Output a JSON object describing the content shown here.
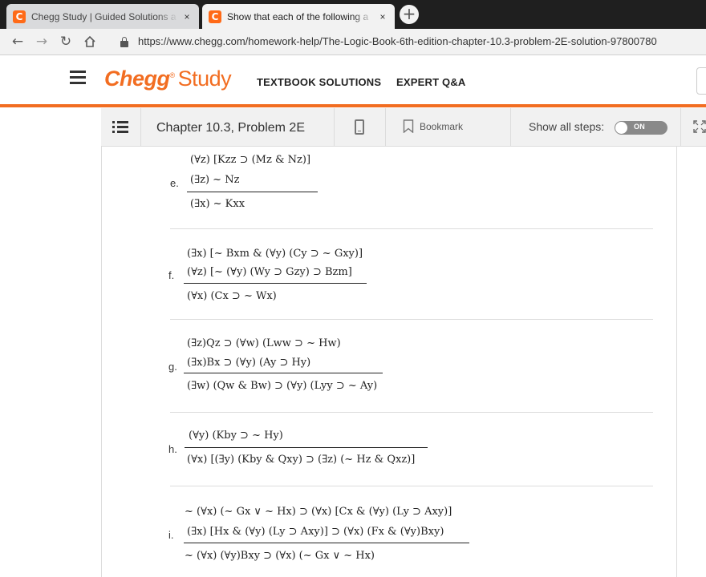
{
  "browser": {
    "tabs": [
      {
        "favicon": "C",
        "title": "Chegg Study | Guided Solutions a",
        "close": "×"
      },
      {
        "favicon": "C",
        "title": "Show that each of the following a",
        "close": "×"
      }
    ],
    "new_tab": "+",
    "url": "https://www.chegg.com/homework-help/The-Logic-Book-6th-edition-chapter-10.3-problem-2E-solution-97800780",
    "icons": {
      "back": "arrow-left-icon",
      "forward": "arrow-right-icon",
      "reload": "reload-icon",
      "home": "home-icon",
      "lock": "lock-icon"
    }
  },
  "header": {
    "logo_brand": "Chegg",
    "logo_product": "Study",
    "nav": [
      "TEXTBOOK SOLUTIONS",
      "EXPERT Q&A"
    ]
  },
  "subbar": {
    "chapter_title": "Chapter 10.3, Problem 2E",
    "bookmark": "Bookmark",
    "show_steps": "Show all steps:",
    "toggle": "ON"
  },
  "problems": [
    {
      "label": "",
      "premises": [
        "(∀z) [Kzz ⊃ (Mz & Nz)]"
      ],
      "conclusion": ""
    },
    {
      "label": "e.",
      "premises": [
        "(∃z) ~ Nz"
      ],
      "conclusion": "(∃x) ~ Kxx"
    },
    {
      "label": "f.",
      "premises": [
        "(∃x) [~ Bxm & (∀y) (Cy ⊃ ~ Gxy)]",
        "(∀z) [~ (∀y) (Wy ⊃ Gzy) ⊃ Bzm]"
      ],
      "conclusion": "(∀x) (Cx ⊃ ~ Wx)"
    },
    {
      "label": "g.",
      "premises": [
        "(∃z)Qz ⊃ (∀w) (Lww ⊃ ~ Hw)",
        "(∃x)Bx ⊃ (∀y) (Ay ⊃ Hy)"
      ],
      "conclusion": "(∃w) (Qw & Bw) ⊃ (∀y) (Lyy ⊃ ~ Ay)"
    },
    {
      "label": "h.",
      "premises": [
        "(∀y) (Kby ⊃ ~ Hy)"
      ],
      "conclusion": "(∀x) [(∃y) (Kby & Qxy) ⊃ (∃z) (~ Hz & Qxz)]"
    },
    {
      "label": "i.",
      "premises": [
        "~ (∀x) (~ Gx ∨ ~ Hx) ⊃ (∀x) [Cx & (∀y) (Ly ⊃ Axy)]",
        "(∃x) [Hx & (∀y) (Ly ⊃ Axy)] ⊃ (∀x) (Fx & (∀y)Bxy)"
      ],
      "conclusion": "~ (∀x) (∀y)Bxy ⊃ (∀x) (~ Gx ∨ ~ Hx)"
    }
  ],
  "colors": {
    "brand": "#f26d21",
    "toolbar": "#f1f1f1",
    "text": "#222222"
  }
}
